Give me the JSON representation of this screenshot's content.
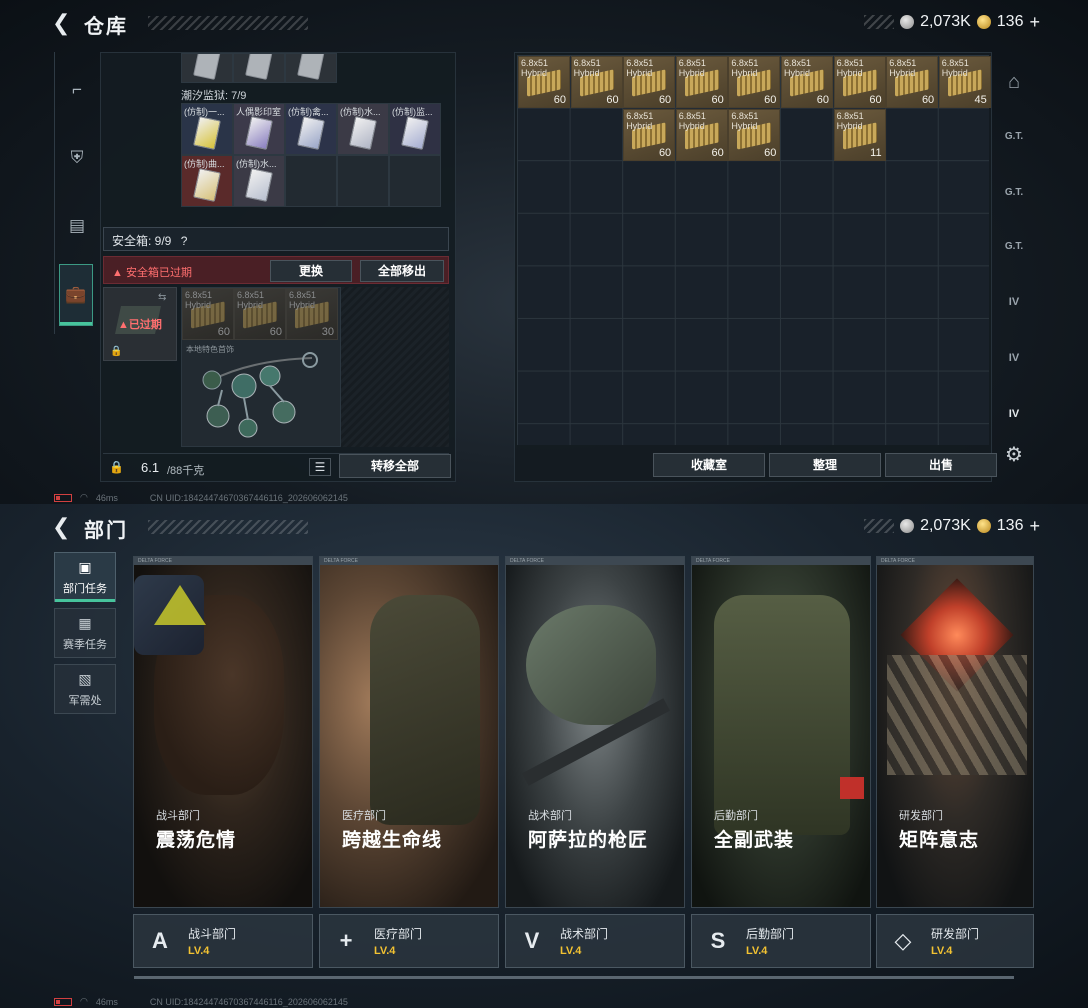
{
  "warehouse": {
    "title": "仓库",
    "back_icon": "chevron-left-icon",
    "currency": {
      "silver": "2,073K",
      "gold": "136",
      "plus": "+"
    },
    "nav_icons": [
      "gun-icon",
      "armor-icon",
      "vest-icon",
      "briefcase-icon"
    ],
    "top_strip_items": 3,
    "tidal_label": "潮汐监狱: 7/9",
    "keycards": [
      {
        "label": "(仿制)一...",
        "color": "#2a3448",
        "card": "#d7c23a"
      },
      {
        "label": "人偶影印室",
        "color": "#3c3a4a",
        "card": "#8a7fc0"
      },
      {
        "label": "(仿制)禽...",
        "color": "#2c3349",
        "card": "#9aa6c8"
      },
      {
        "label": "(仿制)水...",
        "color": "#3b3a46",
        "card": "#b0b5c5"
      },
      {
        "label": "(仿制)监...",
        "color": "#2f3144",
        "card": "#a6aed2"
      },
      {
        "label": "(仿制)曲...",
        "color": "#5a2a2a",
        "card": "#d8c27a"
      },
      {
        "label": "(仿制)水...",
        "color": "#3b3a46",
        "card": "#b9c0d0"
      }
    ],
    "safebox": {
      "label": "安全箱: 9/9",
      "help": "?",
      "expired_text": "安全箱已过期",
      "replace_btn": "更换",
      "remove_all_btn": "全部移出",
      "expired_tag": "已过期",
      "ammo": [
        {
          "name": "6.8x51\nHybrid",
          "count": "60"
        },
        {
          "name": "6.8x51\nHybrid",
          "count": "60"
        },
        {
          "name": "6.8x51\nHybrid",
          "count": "30"
        }
      ],
      "local_special_label": "本地特色首饰"
    },
    "weight": {
      "value": "6.1",
      "max": "/88千克"
    },
    "transfer_all_btn": "转移全部",
    "storage_ammo": [
      {
        "name": "6.8x51\nHybrid",
        "count": "60"
      },
      {
        "name": "6.8x51\nHybrid",
        "count": "60"
      },
      {
        "name": "6.8x51\nHybrid",
        "count": "60"
      },
      {
        "name": "6.8x51\nHybrid",
        "count": "60"
      },
      {
        "name": "6.8x51\nHybrid",
        "count": "60"
      },
      {
        "name": "6.8x51\nHybrid",
        "count": "60"
      },
      {
        "name": "6.8x51\nHybrid",
        "count": "60"
      },
      {
        "name": "6.8x51\nHybrid",
        "count": "60"
      },
      {
        "name": "6.8x51\nHybrid",
        "count": "45"
      },
      {
        "name": "6.8x51\nHybrid",
        "count": "60"
      },
      {
        "name": "6.8x51\nHybrid",
        "count": "60"
      },
      {
        "name": "6.8x51\nHybrid",
        "count": "60"
      },
      {
        "name": "6.8x51\nHybrid",
        "count": "11"
      }
    ],
    "bottom_buttons": {
      "collection": "收藏室",
      "sort": "整理",
      "sell": "出售"
    },
    "right_tools": [
      "helmet-icon",
      "gtu-icon",
      "gtu-icon",
      "gtu-icon",
      "iv-icon",
      "iv-icon",
      "iv-icon"
    ],
    "status": {
      "ping": "46ms",
      "uid": "CN UID:18424474670367446116_202606062145"
    }
  },
  "department": {
    "title": "部门",
    "currency": {
      "silver": "2,073K",
      "gold": "136",
      "plus": "+"
    },
    "tabs": [
      {
        "label": "部门任务",
        "icon": "clipboard-icon"
      },
      {
        "label": "赛季任务",
        "icon": "crate-icon"
      },
      {
        "label": "军需处",
        "icon": "supply-icon"
      }
    ],
    "cards": [
      {
        "category": "战斗部门",
        "name": "震荡危情",
        "dept": "战斗部门",
        "level": "LV.4",
        "emblem": "A"
      },
      {
        "category": "医疗部门",
        "name": "跨越生命线",
        "dept": "医疗部门",
        "level": "LV.4",
        "emblem": "+"
      },
      {
        "category": "战术部门",
        "name": "阿萨拉的枪匠",
        "dept": "战术部门",
        "level": "LV.4",
        "emblem": "V"
      },
      {
        "category": "后勤部门",
        "name": "全副武装",
        "dept": "后勤部门",
        "level": "LV.4",
        "emblem": "S"
      },
      {
        "category": "研发部门",
        "name": "矩阵意志",
        "dept": "研发部门",
        "level": "LV.4",
        "emblem": "◇"
      }
    ],
    "card_header": "DELTA FORCE",
    "status": {
      "ping": "46ms",
      "uid": "CN UID:18424474670367446116_202606062145"
    }
  },
  "colors": {
    "accent": "#47c49c",
    "warning": "#ff6f6f",
    "level": "#f2c232"
  }
}
